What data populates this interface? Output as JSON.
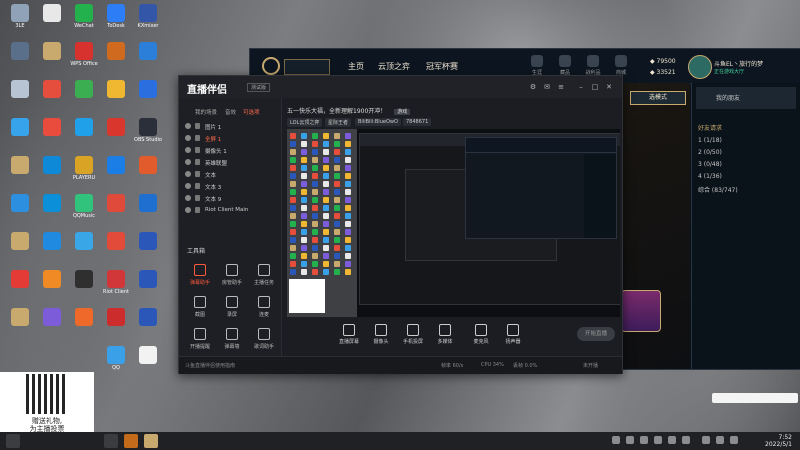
{
  "desktop": {
    "icons": [
      {
        "label": "3LE",
        "color": "#8fa2b8",
        "col": 0,
        "row": 0
      },
      {
        "label": "",
        "color": "#e8e8e8",
        "col": 1,
        "row": 0
      },
      {
        "label": "WeChat",
        "color": "#22b14c",
        "col": 2,
        "row": 0
      },
      {
        "label": "ToDesk",
        "color": "#2d7df6",
        "col": 3,
        "row": 0
      },
      {
        "label": "KXmixer",
        "color": "#3356a8",
        "col": 4,
        "row": 0
      },
      {
        "label": "",
        "color": "#5a6f8a",
        "col": 0,
        "row": 1
      },
      {
        "label": "",
        "color": "#c8aa6e",
        "col": 1,
        "row": 1
      },
      {
        "label": "WPS Office",
        "color": "#d7322e",
        "col": 2,
        "row": 1
      },
      {
        "label": "",
        "color": "#d06a1e",
        "col": 3,
        "row": 1
      },
      {
        "label": "",
        "color": "#2b7fd8",
        "col": 4,
        "row": 1
      },
      {
        "label": "",
        "color": "#b7c4d3",
        "col": 0,
        "row": 2
      },
      {
        "label": "",
        "color": "#e54d3c",
        "col": 1,
        "row": 2
      },
      {
        "label": "",
        "color": "#3cae52",
        "col": 2,
        "row": 2
      },
      {
        "label": "",
        "color": "#f0b830",
        "col": 3,
        "row": 2
      },
      {
        "label": "",
        "color": "#2a6ee0",
        "col": 4,
        "row": 2
      },
      {
        "label": "",
        "color": "#36a3ea",
        "col": 0,
        "row": 3
      },
      {
        "label": "",
        "color": "#e94b3c",
        "col": 1,
        "row": 3
      },
      {
        "label": "",
        "color": "#1fa0e8",
        "col": 2,
        "row": 3
      },
      {
        "label": "",
        "color": "#d9372e",
        "col": 3,
        "row": 3
      },
      {
        "label": "OBS Studio",
        "color": "#2b2f3a",
        "col": 4,
        "row": 3
      },
      {
        "label": "",
        "color": "#c8aa6e",
        "col": 0,
        "row": 4
      },
      {
        "label": "",
        "color": "#0e89d8",
        "col": 1,
        "row": 4
      },
      {
        "label": "PLAYERU",
        "color": "#d9a326",
        "col": 2,
        "row": 4
      },
      {
        "label": "",
        "color": "#1b7ee6",
        "col": 3,
        "row": 4
      },
      {
        "label": "",
        "color": "#e25b2c",
        "col": 4,
        "row": 4
      },
      {
        "label": "",
        "color": "#2d8fe0",
        "col": 0,
        "row": 5
      },
      {
        "label": "",
        "color": "#0b8fd8",
        "col": 1,
        "row": 5
      },
      {
        "label": "QQMusic",
        "color": "#31c27c",
        "col": 2,
        "row": 5
      },
      {
        "label": "",
        "color": "#e04a3a",
        "col": 3,
        "row": 5
      },
      {
        "label": "",
        "color": "#1f6fd0",
        "col": 4,
        "row": 5
      },
      {
        "label": "",
        "color": "#c8aa6e",
        "col": 0,
        "row": 6
      },
      {
        "label": "",
        "color": "#1f8ae0",
        "col": 1,
        "row": 6
      },
      {
        "label": "",
        "color": "#39a6e8",
        "col": 2,
        "row": 6
      },
      {
        "label": "",
        "color": "#e24b3a",
        "col": 3,
        "row": 6
      },
      {
        "label": "",
        "color": "#2a57b8",
        "col": 4,
        "row": 6
      },
      {
        "label": "",
        "color": "#e43b37",
        "col": 0,
        "row": 7
      },
      {
        "label": "",
        "color": "#f08a24",
        "col": 1,
        "row": 7
      },
      {
        "label": "",
        "color": "#2f2f2f",
        "col": 2,
        "row": 7
      },
      {
        "label": "Riot Client",
        "color": "#d13639",
        "col": 3,
        "row": 7
      },
      {
        "label": "",
        "color": "#2a57b8",
        "col": 4,
        "row": 7
      },
      {
        "label": "",
        "color": "#c8aa6e",
        "col": 0,
        "row": 8
      },
      {
        "label": "",
        "color": "#7c5cd8",
        "col": 1,
        "row": 8
      },
      {
        "label": "",
        "color": "#ef6a2a",
        "col": 2,
        "row": 8
      },
      {
        "label": "",
        "color": "#cc2c2c",
        "col": 3,
        "row": 8
      },
      {
        "label": "",
        "color": "#2a57b8",
        "col": 4,
        "row": 8
      },
      {
        "label": "QQ",
        "color": "#3aa0e8",
        "col": 3,
        "row": 9
      },
      {
        "label": "",
        "color": "#f2f2f2",
        "col": 4,
        "row": 9
      }
    ]
  },
  "qr_widget": {
    "line1": "赠送礼物,",
    "line2": "为主播投票"
  },
  "taskbar": {
    "time": "7:52",
    "date": "2022/5/1"
  },
  "lol": {
    "nav": [
      "主页",
      "云顶之弈",
      "冠军杯赛"
    ],
    "tools": [
      "生涯",
      "藏品",
      "战利品",
      "商城"
    ],
    "be": "79500",
    "rp": "33521",
    "username": "斗鱼EL丶旅行的梦",
    "status": "正在游戏大厅",
    "mode_btn": "选模式",
    "group": "我的朋友",
    "friend_groups": [
      "好友请求",
      "1 (1/18)",
      "2 (0/50)",
      "3 (0/48)",
      "4 (1/36)",
      "综合 (83/747)"
    ]
  },
  "app": {
    "title": "直播伴侣",
    "tag": "测试版",
    "tabs": [
      "我的场景",
      "音效",
      "可选项"
    ],
    "scenes": [
      {
        "name": "图片 1",
        "sel": false
      },
      {
        "name": "全屏 1",
        "sel": true
      },
      {
        "name": "摄像头 1",
        "sel": false
      },
      {
        "name": "英雄联盟",
        "sel": false
      },
      {
        "name": "文本",
        "sel": false
      },
      {
        "name": "文本 3",
        "sel": false
      },
      {
        "name": "文本 9",
        "sel": false
      },
      {
        "name": "Riot Client Main",
        "sel": false
      }
    ],
    "tools_title": "工具箱",
    "tools": [
      {
        "label": "弹幕助手",
        "hot": true
      },
      {
        "label": "房管助手",
        "hot": false
      },
      {
        "label": "主播任务",
        "hot": false
      },
      {
        "label": "截图",
        "hot": false
      },
      {
        "label": "录屏",
        "hot": false
      },
      {
        "label": "连麦",
        "hot": false
      },
      {
        "label": "开播提醒",
        "hot": false
      },
      {
        "label": "弹幕墙",
        "hot": false
      },
      {
        "label": "歌词助手",
        "hot": false
      }
    ],
    "info": "五一快乐大福，全新理解1900开冲！",
    "info_badge": "游戏",
    "chips": [
      "LOL云顶之弈",
      "星际王者",
      "BiliBili:BlueOwO",
      "7848671"
    ],
    "bottom": [
      "直播屏幕",
      "摄像头",
      "手机投屏",
      "多媒体",
      "麦克风",
      "扬声器"
    ],
    "start": "开始直播",
    "status_left": "斗鱼直播伴侣使用指南",
    "status_right": [
      "帧率 60/s",
      "CPU 34%",
      "丢帧 0.0%",
      "未开播"
    ]
  }
}
